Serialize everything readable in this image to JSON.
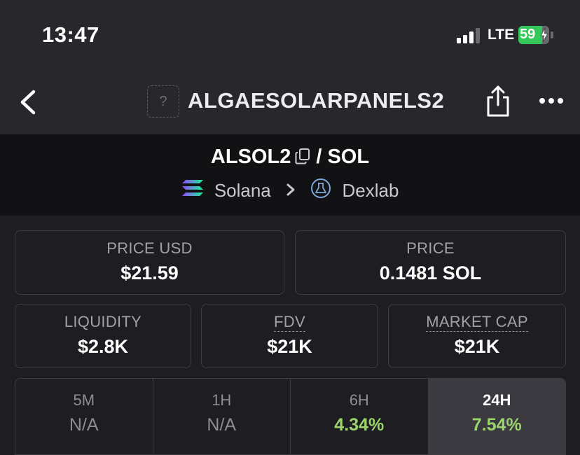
{
  "status_bar": {
    "time": "13:47",
    "network": "LTE",
    "battery": "59",
    "signal_icon": "cellular-signal-icon",
    "battery_color": "#34c759"
  },
  "nav": {
    "back_icon": "chevron-left-icon",
    "token_placeholder": "?",
    "title": "ALGAESOLARPANELS2",
    "share_icon": "share-icon",
    "more_icon": "ellipsis-icon"
  },
  "pair": {
    "base": "ALSOL2",
    "separator": "/",
    "quote": "SOL",
    "copy_icon": "copy-icon",
    "chain": "Solana",
    "dex": "Dexlab",
    "chain_icon": "solana-logo-icon",
    "dex_icon": "dexlab-logo-icon"
  },
  "stats": {
    "price_usd": {
      "label": "PRICE USD",
      "value": "$21.59"
    },
    "price": {
      "label": "PRICE",
      "value": "0.1481 SOL"
    },
    "liquidity": {
      "label": "LIQUIDITY",
      "value": "$2.8K"
    },
    "fdv": {
      "label": "FDV",
      "value": "$21K"
    },
    "market_cap": {
      "label": "MARKET CAP",
      "value": "$21K"
    }
  },
  "timeframes": [
    {
      "label": "5M",
      "value": "N/A",
      "active": false
    },
    {
      "label": "1H",
      "value": "N/A",
      "active": false
    },
    {
      "label": "6H",
      "value": "4.34%",
      "active": false
    },
    {
      "label": "24H",
      "value": "7.54%",
      "active": true
    }
  ],
  "colors": {
    "positive": "#9ad46a",
    "background": "#1e1e22",
    "header": "#28282c"
  }
}
